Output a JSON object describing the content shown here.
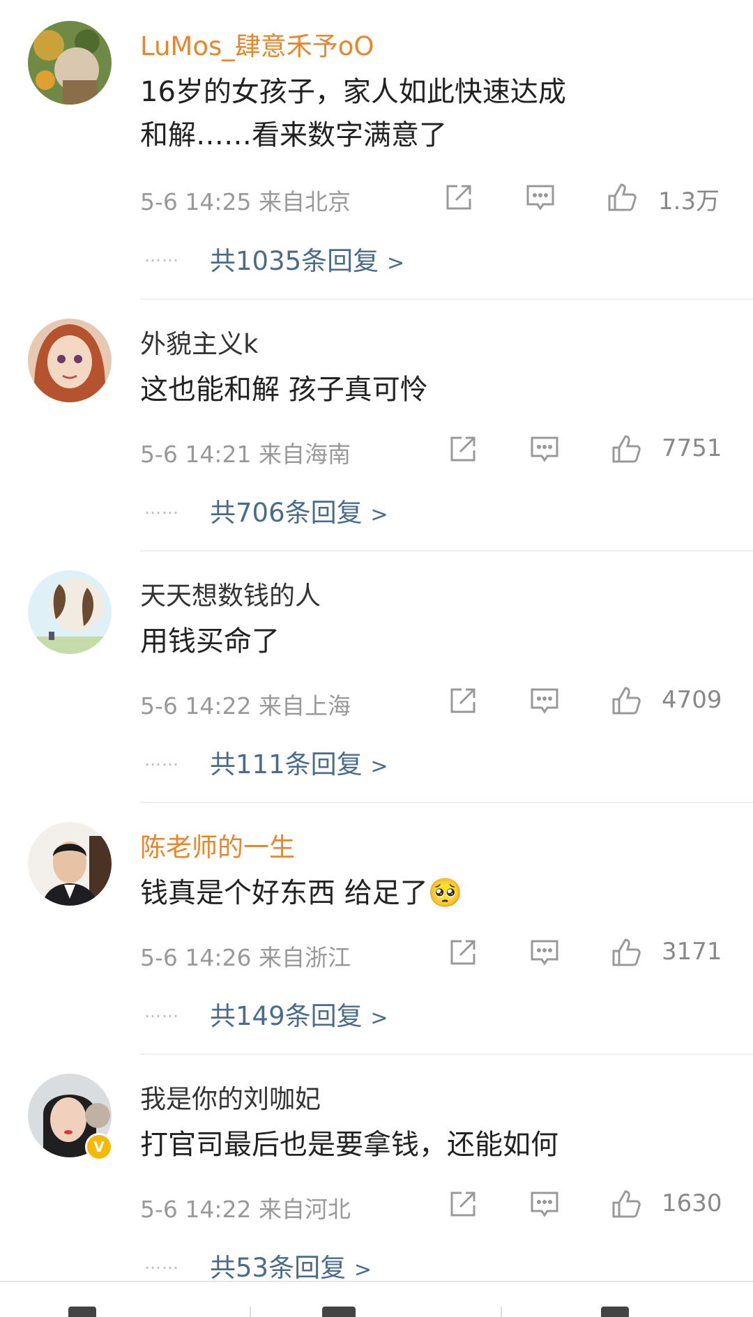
{
  "comments": [
    {
      "username": "LuMos_肆意禾予oO",
      "vip": true,
      "text": "16岁的女孩子，家人如此快速达成和解……看来数字满意了",
      "time": "5-6 14:25",
      "location": "来自北京",
      "likes": "1.3万",
      "replies": "共1035条回复",
      "chevron": ">"
    },
    {
      "username": "外貌主义k",
      "vip": false,
      "text": "这也能和解 孩子真可怜",
      "time": "5-6 14:21",
      "location": "来自海南",
      "likes": "7751",
      "replies": "共706条回复",
      "chevron": ">"
    },
    {
      "username": "天天想数钱的人",
      "vip": false,
      "text": "用钱买命了",
      "time": "5-6 14:22",
      "location": "来自上海",
      "likes": "4709",
      "replies": "共111条回复",
      "chevron": ">"
    },
    {
      "username": "陈老师的一生",
      "vip": true,
      "text": "钱真是个好东西 给足了🥺",
      "time": "5-6 14:26",
      "location": "来自浙江",
      "likes": "3171",
      "replies": "共149条回复",
      "chevron": ">"
    },
    {
      "username": "我是你的刘咖妃",
      "vip": false,
      "verified": true,
      "text": "打官司最后也是要拿钱，还能如何",
      "time": "5-6 14:22",
      "location": "来自河北",
      "likes": "1630",
      "replies": "共53条回复",
      "chevron": ">"
    }
  ],
  "dots": "……",
  "verified_mark": "V",
  "icons": {
    "share": "share-icon",
    "comment": "comment-icon",
    "like": "thumbs-up-icon"
  },
  "colors": {
    "vip_name": "#e8852d",
    "reply_link": "#4a6b8a",
    "meta": "#999999",
    "verified_badge": "#f6b800"
  }
}
